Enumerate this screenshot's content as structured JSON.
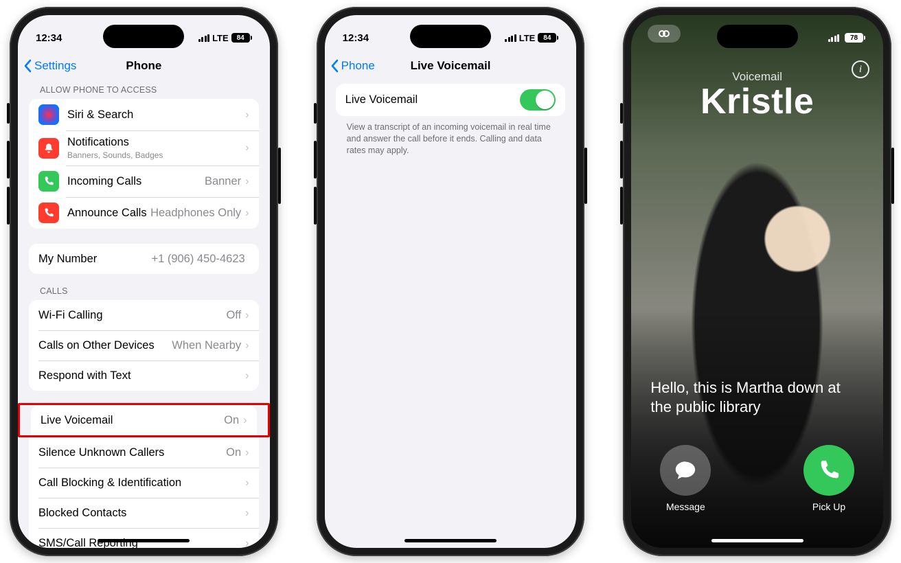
{
  "phone1": {
    "status": {
      "time": "12:34",
      "carrier": "LTE",
      "battery": "84"
    },
    "nav": {
      "back": "Settings",
      "title": "Phone"
    },
    "section_access_header": "ALLOW PHONE TO ACCESS",
    "rows_access": {
      "siri": {
        "label": "Siri & Search"
      },
      "notif": {
        "label": "Notifications",
        "sub": "Banners, Sounds, Badges"
      },
      "incoming": {
        "label": "Incoming Calls",
        "value": "Banner"
      },
      "announce": {
        "label": "Announce Calls",
        "value": "Headphones Only"
      }
    },
    "my_number": {
      "label": "My Number",
      "value": "+1 (906) 450-4623"
    },
    "section_calls_header": "CALLS",
    "rows_calls": {
      "wifi": {
        "label": "Wi-Fi Calling",
        "value": "Off"
      },
      "other": {
        "label": "Calls on Other Devices",
        "value": "When Nearby"
      },
      "respond": {
        "label": "Respond with Text"
      }
    },
    "rows_calls2_before": {
      "live": {
        "label": "Live Voicemail",
        "value": "On"
      }
    },
    "rows_calls2_after": {
      "silence": {
        "label": "Silence Unknown Callers",
        "value": "On"
      },
      "block": {
        "label": "Call Blocking & Identification"
      },
      "blocked": {
        "label": "Blocked Contacts"
      },
      "sms": {
        "label": "SMS/Call Reporting"
      }
    }
  },
  "phone2": {
    "status": {
      "time": "12:34",
      "carrier": "LTE",
      "battery": "84"
    },
    "nav": {
      "back": "Phone",
      "title": "Live Voicemail"
    },
    "row": {
      "label": "Live Voicemail"
    },
    "footer": "View a transcript of an incoming voicemail in real time and answer the call before it ends. Calling and data rates may apply."
  },
  "phone3": {
    "status": {
      "carrier": "",
      "battery": "78"
    },
    "caller": {
      "kind": "Voicemail",
      "name": "Kristle"
    },
    "transcript": "Hello, this is Martha down at the public library",
    "actions": {
      "message": "Message",
      "pickup": "Pick Up"
    }
  }
}
